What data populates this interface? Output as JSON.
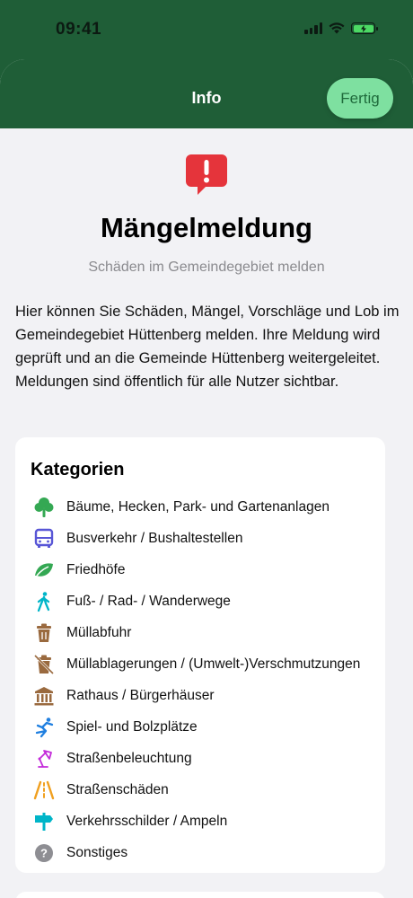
{
  "status_bar": {
    "time": "09:41"
  },
  "nav": {
    "title": "Info",
    "done_label": "Fertig"
  },
  "header": {
    "icon": "exclamation-speech-bubble-icon",
    "title": "Mängelmeldung",
    "subtitle": "Schäden im Gemeindegebiet melden"
  },
  "description": "Hier können Sie Schäden, Mängel, Vorschläge und Lob im Gemeindegebiet Hüttenberg melden. Ihre Meldung wird geprüft und an die Gemeinde Hüttenberg weitergeleitet. Meldungen sind öffentlich für alle Nutzer sichtbar.",
  "categories": {
    "title": "Kategorien",
    "items": [
      {
        "label": "Bäume, Hecken, Park- und Gartenanlagen",
        "icon": "tree-icon",
        "color": "#34a853"
      },
      {
        "label": "Busverkehr / Bushaltestellen",
        "icon": "bus-icon",
        "color": "#5856d6"
      },
      {
        "label": "Friedhöfe",
        "icon": "leaf-icon",
        "color": "#34a853"
      },
      {
        "label": "Fuß- / Rad- / Wanderwege",
        "icon": "walking-person-icon",
        "color": "#00b5c8"
      },
      {
        "label": "Müllabfuhr",
        "icon": "trash-icon",
        "color": "#9a6a3f"
      },
      {
        "label": "Müllablagerungen / (Umwelt-)Verschmutzungen",
        "icon": "trash-slash-icon",
        "color": "#9a6a3f"
      },
      {
        "label": "Rathaus / Bürgerhäuser",
        "icon": "building-columns-icon",
        "color": "#9a6a3f"
      },
      {
        "label": "Spiel- und Bolzplätze",
        "icon": "figure-play-icon",
        "color": "#1f7fe0"
      },
      {
        "label": "Straßenbeleuchtung",
        "icon": "lamp-icon",
        "color": "#c32bd9"
      },
      {
        "label": "Straßenschäden",
        "icon": "road-icon",
        "color": "#f0a020"
      },
      {
        "label": "Verkehrsschilder / Ampeln",
        "icon": "signpost-icon",
        "color": "#00b5c8"
      },
      {
        "label": "Sonstiges",
        "icon": "question-circle-icon",
        "color": "#8e8e93"
      }
    ]
  }
}
